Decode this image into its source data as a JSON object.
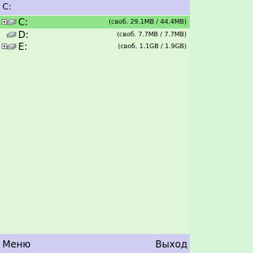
{
  "header": {
    "title": "C:"
  },
  "drives": [
    {
      "label": "C:",
      "info": "(своб. 29.1MB / 44.4MB)",
      "selected": true,
      "expandable": true
    },
    {
      "label": "D:",
      "info": "(своб. 7.7MB / 7.7MB)",
      "selected": false,
      "expandable": false
    },
    {
      "label": "E:",
      "info": "(своб. 1.1GB / 1.9GB)",
      "selected": false,
      "expandable": true
    }
  ],
  "softkeys": {
    "left": "Меню",
    "right": "Выход"
  },
  "colors": {
    "title_bar": "#cfcdf2",
    "content_bg": "#e0f6d8",
    "selection": "#90e48a",
    "softkey_bar": "#cfcdf2"
  }
}
